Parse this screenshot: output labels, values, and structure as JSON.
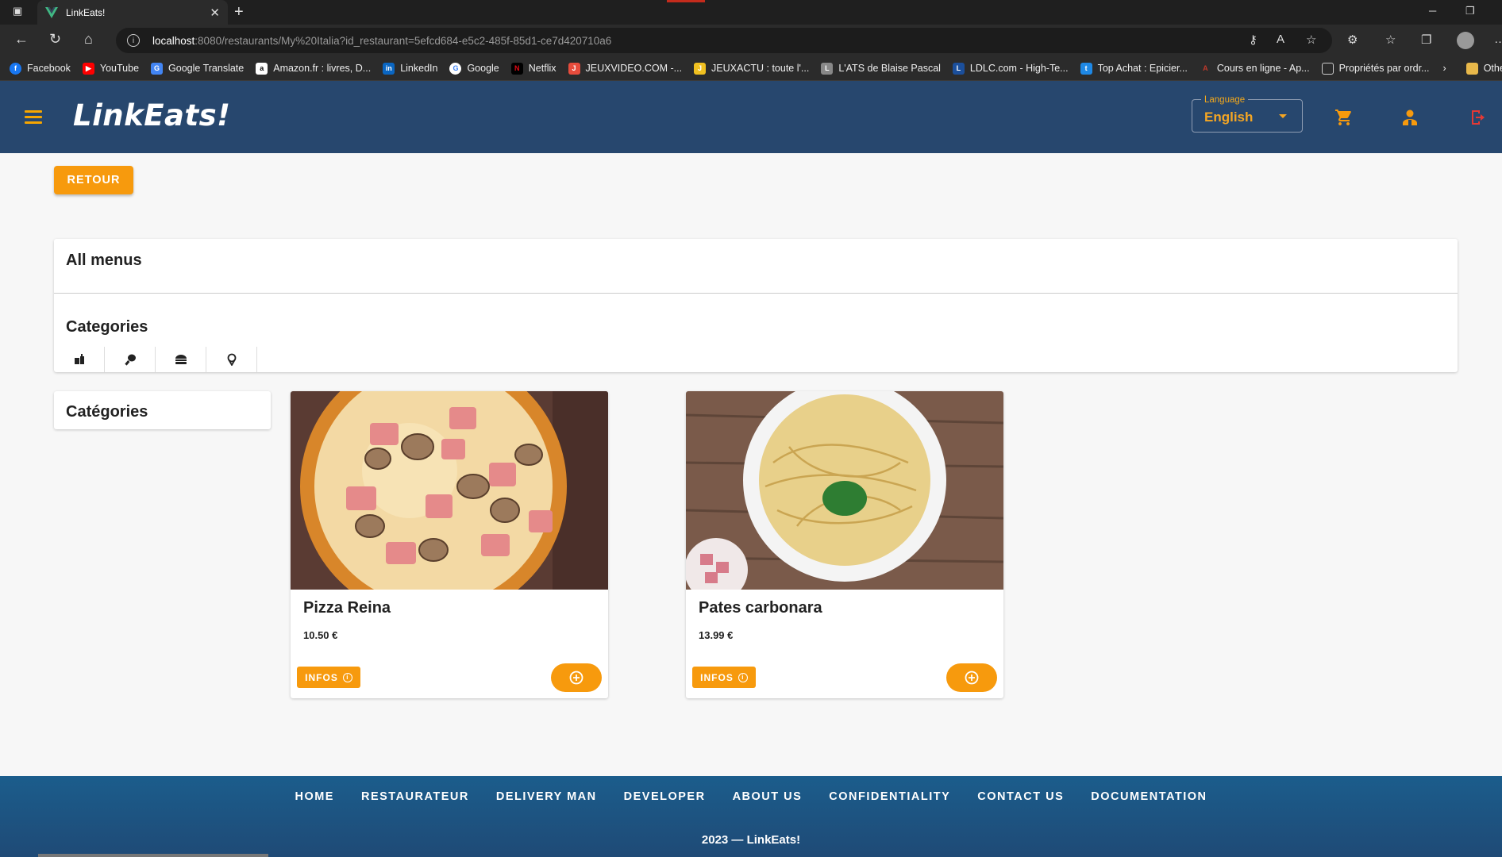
{
  "browser": {
    "tab_title": "LinkEats!",
    "url_host": "localhost",
    "url_path": ":8080/restaurants/My%20Italia?id_restaurant=5efcd684-e5c2-485f-85d1-ce7d420710a6",
    "bookmarks": [
      {
        "label": "Facebook",
        "color": "#1877f2",
        "icon": "f"
      },
      {
        "label": "YouTube",
        "color": "#ff0000",
        "icon": "▶"
      },
      {
        "label": "Google Translate",
        "color": "#4285f4",
        "icon": "G"
      },
      {
        "label": "Amazon.fr : livres, D...",
        "color": "#ffffff",
        "icon": "a"
      },
      {
        "label": "LinkedIn",
        "color": "#0a66c2",
        "icon": "in"
      },
      {
        "label": "Google",
        "color": "#ffffff",
        "icon": "G"
      },
      {
        "label": "Netflix",
        "color": "#e50914",
        "icon": "N"
      },
      {
        "label": "JEUXVIDEO.COM -...",
        "color": "#e74c3c",
        "icon": "J"
      },
      {
        "label": "JEUXACTU : toute l'...",
        "color": "#f0c020",
        "icon": "J"
      },
      {
        "label": "L'ATS de Blaise Pascal",
        "color": "#888888",
        "icon": "L"
      },
      {
        "label": "LDLC.com - High-Te...",
        "color": "#1b4f9c",
        "icon": "L"
      },
      {
        "label": "Top Achat : Epicier...",
        "color": "#1e88e5",
        "icon": "t"
      },
      {
        "label": "Cours en ligne - Ap...",
        "color": "#c0392b",
        "icon": "A"
      },
      {
        "label": "Propriétés par ordr...",
        "color": "#cccccc",
        "icon": "□"
      }
    ],
    "other_favorites": "Other favor"
  },
  "header": {
    "logo": "LinkEats!",
    "language_label": "Language",
    "language_value": "English"
  },
  "content": {
    "back_button": "RETOUR",
    "all_menus": "All menus",
    "categories_title": "Categories",
    "side_title": "Catégories",
    "category_icons": [
      "drink-icon",
      "drumstick-icon",
      "burger-icon",
      "icecream-icon"
    ]
  },
  "products": [
    {
      "name": "Pizza Reina",
      "price": "10.50 €",
      "infos_label": "INFOS"
    },
    {
      "name": "Pates carbonara",
      "price": "13.99 €",
      "infos_label": "INFOS"
    }
  ],
  "footer": {
    "links": [
      "HOME",
      "RESTAURATEUR",
      "DELIVERY MAN",
      "DEVELOPER",
      "ABOUT US",
      "CONFIDENTIALITY",
      "CONTACT US",
      "DOCUMENTATION"
    ],
    "copyright": "2023 — LinkEats!"
  },
  "colors": {
    "header_bg": "#27476e",
    "accent": "#f79a0d",
    "footer_bg": "#1f4a76"
  }
}
